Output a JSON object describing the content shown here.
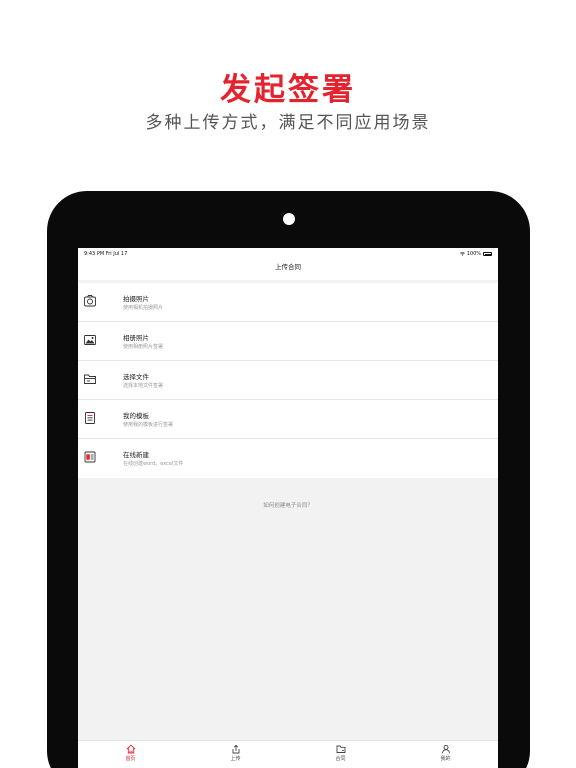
{
  "colors": {
    "accent": "#e4232e",
    "tablet_frame": "#0a0a0a"
  },
  "headline": "发起签署",
  "subheadline": "多种上传方式，满足不同应用场景",
  "status_bar": {
    "time": "9:43 PM  Fri Jul 17",
    "battery": "100%"
  },
  "navbar": {
    "title": "上传合同"
  },
  "menu": {
    "items": [
      {
        "icon": "camera-icon",
        "title": "拍摄照片",
        "desc": "使用相机拍摄照片"
      },
      {
        "icon": "photo-album-icon",
        "title": "相册照片",
        "desc": "使用相册照片签署"
      },
      {
        "icon": "folder-icon",
        "title": "选择文件",
        "desc": "选择本地文件签署"
      },
      {
        "icon": "template-icon",
        "title": "我的模板",
        "desc": "使用我的模板进行签署"
      },
      {
        "icon": "new-document-icon",
        "title": "在线新建",
        "desc": "在线创建word、excel文件"
      }
    ]
  },
  "help_link": "如何创建电子合同？",
  "tabbar": {
    "tabs": [
      {
        "icon": "home-icon",
        "label": "首页",
        "active": true
      },
      {
        "icon": "upload-icon",
        "label": "上传",
        "active": false
      },
      {
        "icon": "contract-folder-icon",
        "label": "合同",
        "active": false
      },
      {
        "icon": "profile-icon",
        "label": "我的",
        "active": false
      }
    ]
  }
}
